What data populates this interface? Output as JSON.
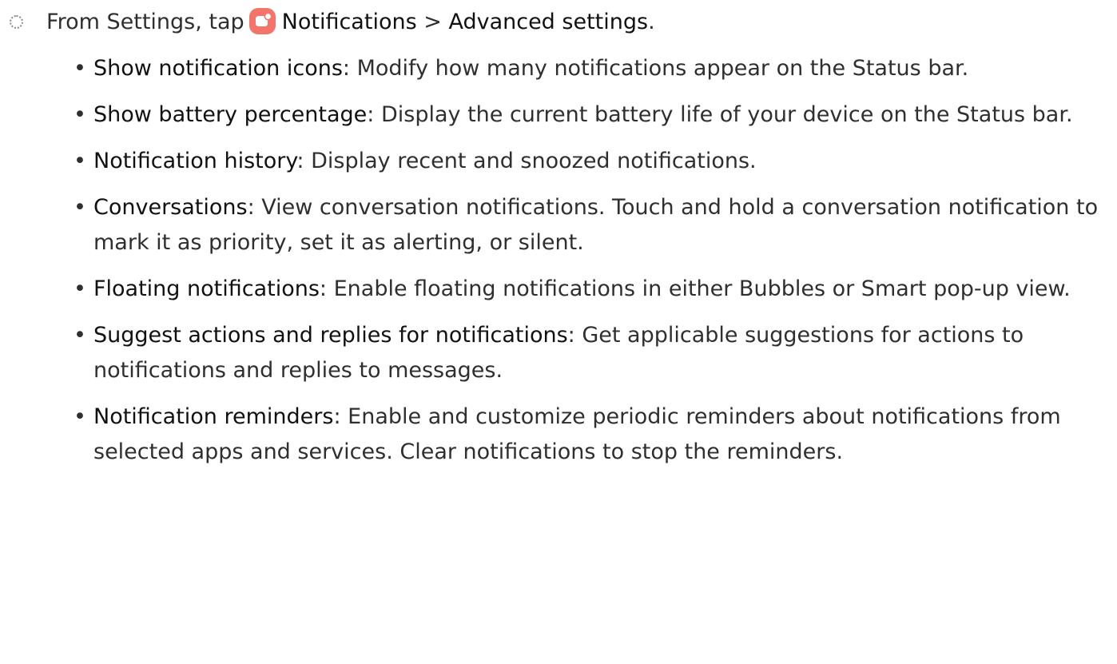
{
  "step": {
    "prefix": "From Settings, tap",
    "app_name": "Notifications",
    "separator": " > ",
    "menu_item": "Advanced settings",
    "suffix": ".",
    "icon": "notifications-app-icon",
    "icon_color": "#f2746a"
  },
  "bullet_glyph": "•",
  "items": [
    {
      "term": "Show notification icons",
      "desc": ": Modify how many notifications appear on the Status bar."
    },
    {
      "term": "Show battery percentage",
      "desc": ": Display the current battery life of your device on the Status bar."
    },
    {
      "term": "Notification history",
      "desc": ": Display recent and snoozed notifications."
    },
    {
      "term": "Conversations",
      "desc": ": View conversation notifications. Touch and hold a conversation notification to mark it as priority, set it as alerting, or silent."
    },
    {
      "term": "Floating notifications",
      "desc": ": Enable floating notifications in either Bubbles or Smart pop-up view."
    },
    {
      "term": "Suggest actions and replies for notifications",
      "desc": ": Get applicable suggestions for actions to notifications and replies to messages."
    },
    {
      "term": "Notification reminders",
      "desc": ": Enable and customize periodic reminders about notifications from selected apps and services. Clear notifications to stop the reminders."
    }
  ]
}
